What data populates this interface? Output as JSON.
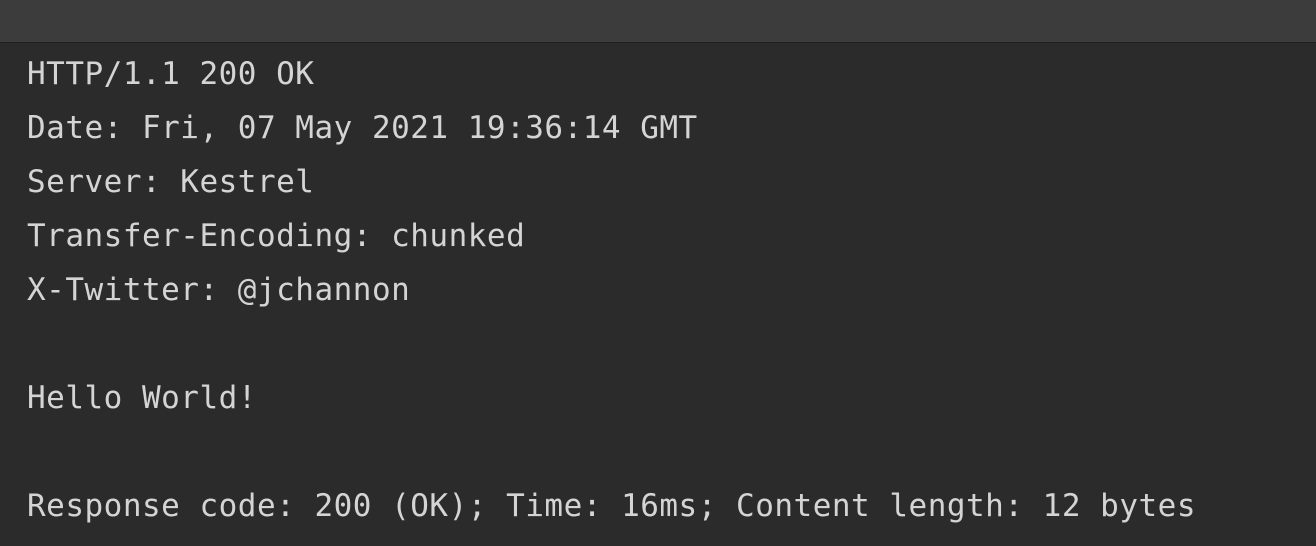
{
  "response": {
    "status_line": "HTTP/1.1 200 OK",
    "headers": [
      "Date: Fri, 07 May 2021 19:36:14 GMT",
      "Server: Kestrel",
      "Transfer-Encoding: chunked",
      "X-Twitter: @jchannon"
    ],
    "body": "Hello World!",
    "summary": "Response code: 200 (OK); Time: 16ms; Content length: 12 bytes"
  }
}
